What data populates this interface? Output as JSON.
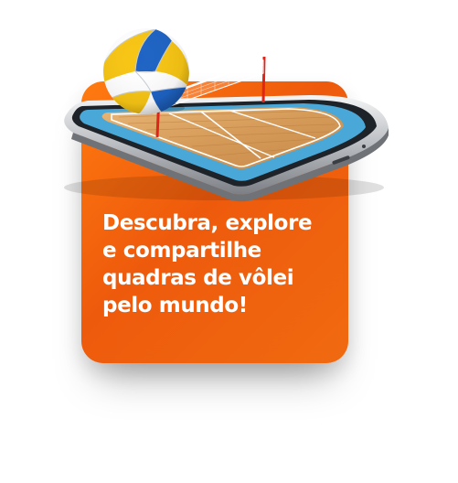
{
  "headline": {
    "line1": "Descubra, explore",
    "line2": "e compartilhe",
    "line3": "quadras de vôlei",
    "line4": "pelo mundo!"
  },
  "colors": {
    "card_orange": "#f26a0e",
    "text": "#ffffff",
    "court_wood": "#d9a05f",
    "court_border": "#4aa8d8",
    "phone_frame": "#c9ccd0"
  },
  "icons": {
    "phone": "smartphone-icon",
    "court": "volleyball-court-icon",
    "net": "volleyball-net-icon",
    "ball": "volleyball-icon"
  }
}
